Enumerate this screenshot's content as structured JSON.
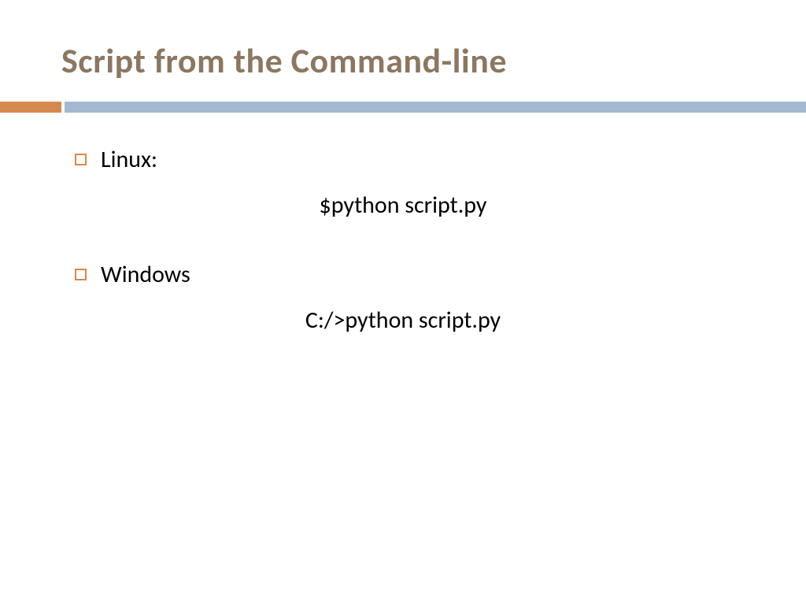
{
  "slide": {
    "title": "Script from the Command-line",
    "items": [
      {
        "label": "Linux:",
        "command": "$python script.py"
      },
      {
        "label": "Windows",
        "command": "C:/>python script.py"
      }
    ]
  }
}
